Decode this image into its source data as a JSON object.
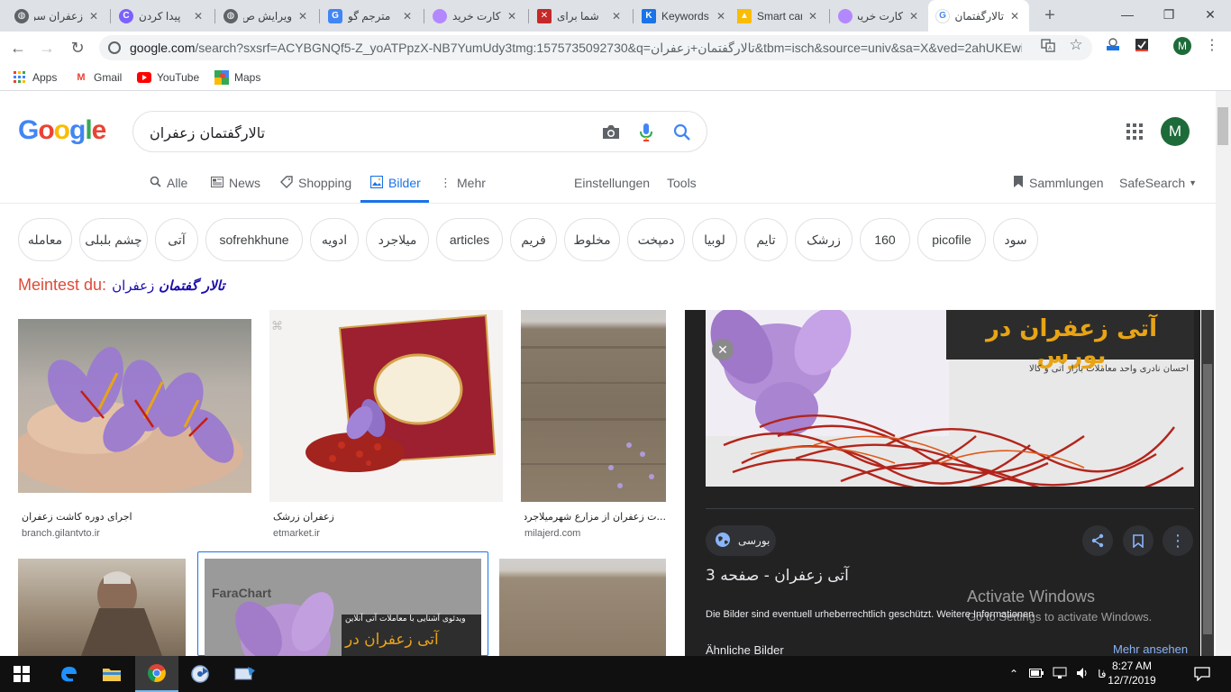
{
  "browser": {
    "tabs": [
      {
        "label": "زعفران سر",
        "fav_color": "#5f6368",
        "fav_glyph": "🌐"
      },
      {
        "label": "پیدا کردن",
        "fav_color": "#7b61ff",
        "fav_glyph": "C"
      },
      {
        "label": "ویرایش ص",
        "fav_color": "#5f6368",
        "fav_glyph": "🌐"
      },
      {
        "label": "مترجم گو",
        "fav_color": "#4285f4",
        "fav_glyph": "G"
      },
      {
        "label": "کارت خرید",
        "fav_color": "#b388ff",
        "fav_glyph": "●"
      },
      {
        "label": "شما برای",
        "fav_color": "#c62828",
        "fav_glyph": "✕"
      },
      {
        "label": "Keywords",
        "fav_color": "#1a73e8",
        "fav_glyph": "K"
      },
      {
        "label": "Smart car",
        "fav_color": "#fbbc04",
        "fav_glyph": "▲"
      },
      {
        "label": "کارت خرید",
        "fav_color": "#b388ff",
        "fav_glyph": "●"
      },
      {
        "label": "تالارگفتمان",
        "fav_color": "#4285f4",
        "fav_glyph": "G"
      }
    ],
    "url_host": "google.com",
    "url_rest": "/search?sxsrf=ACYBGNQf5-Z_yoATPpzX-NB7YumUdy3tmg:1575735092730&q=تالارگفتمان+زعفران&tbm=isch&source=univ&sa=X&ved=2ahUKEwicj...",
    "bookmarks": [
      {
        "label": "Apps",
        "icon": "apps-icon"
      },
      {
        "label": "Gmail",
        "icon": "gmail-icon"
      },
      {
        "label": "YouTube",
        "icon": "youtube-icon"
      },
      {
        "label": "Maps",
        "icon": "maps-icon"
      }
    ],
    "profile_initial": "M"
  },
  "google": {
    "logo": "Google",
    "query": "تالارگفتمان زعفران",
    "avatar": "M",
    "tabs": [
      {
        "label": "Alle",
        "icon": "search-icon"
      },
      {
        "label": "News",
        "icon": "news-icon"
      },
      {
        "label": "Shopping",
        "icon": "tag-icon"
      },
      {
        "label": "Bilder",
        "icon": "image-icon"
      },
      {
        "label": "Mehr",
        "icon": "more-icon"
      }
    ],
    "settings": "Einstellungen",
    "tools": "Tools",
    "collections": "Sammlungen",
    "safesearch": "SafeSearch",
    "chips": [
      "معامله",
      "چشم بلبلی",
      "آتی",
      "sofrehkhune",
      "ادویه",
      "میلاجرد",
      "articles",
      "فریم",
      "مخلوط",
      "دمپخت",
      "لوبیا",
      "تایم",
      "زرشک",
      "160",
      "picofile",
      "سود"
    ],
    "did_you_mean_label": "Meintest du:",
    "did_you_mean_bold": "تالار گفتمان",
    "did_you_mean_rest": "زعفران"
  },
  "results": [
    {
      "title": "اجرای دوره کاشت زعفران",
      "site": "branch.gilantvto.ir"
    },
    {
      "title": "زعفران زرشک",
      "site": "etmarket.ir"
    },
    {
      "title": "...ت زعفران از مزارع شهرمیلاجرد",
      "site": "milajerd.com"
    }
  ],
  "result_second_row": {
    "farachart_label": "FaraChart",
    "banner_small": "ویدئوی آشنایی با معاملات آتی آنلاین",
    "banner_big": "آتی زعفران در بورس"
  },
  "panel": {
    "image_headline": "آتی زعفران در بورس",
    "image_sub": "احسان نادری واحد معاملات بازار آتی و کالا",
    "source": "بورسی",
    "title": "آتی زعفران - صفحه 3",
    "copyright": "Die Bilder sind eventuell urheberrechtlich geschützt. Weitere Informationen",
    "similar": "Ähnliche Bilder",
    "more": "Mehr ansehen",
    "activate_title": "Activate Windows",
    "activate_sub": "Go to Settings to activate Windows."
  },
  "taskbar": {
    "lang": "فا",
    "time": "8:27 AM",
    "date": "12/7/2019"
  }
}
